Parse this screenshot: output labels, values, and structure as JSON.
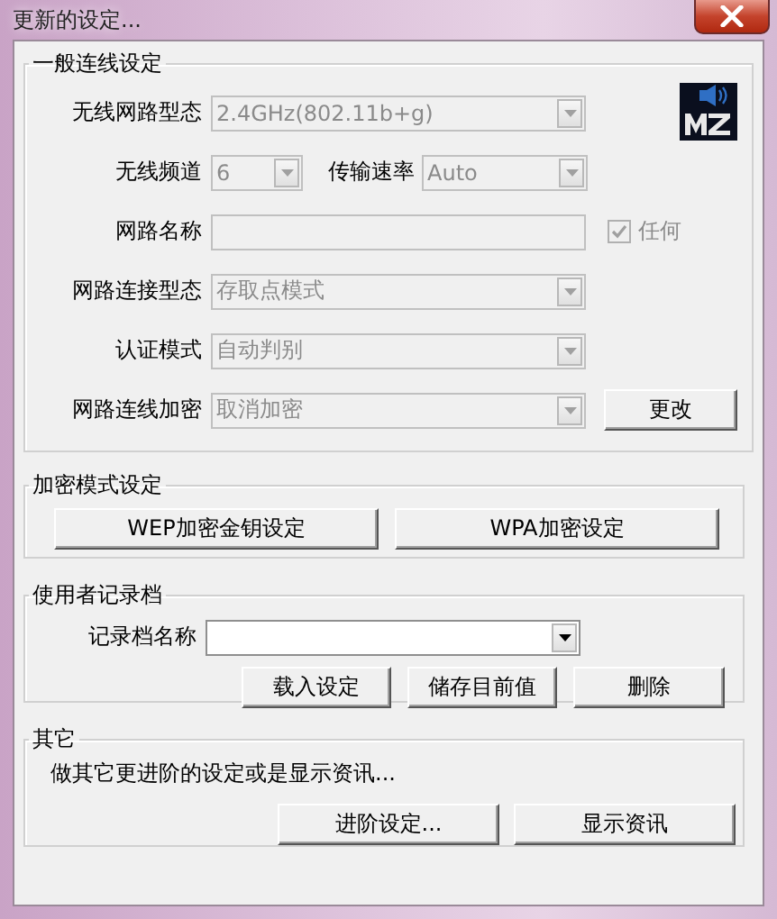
{
  "window": {
    "title": "更新的设定..."
  },
  "general": {
    "title": "一般连线设定",
    "rows": [
      {
        "items": [
          {
            "kind": "label",
            "text": "无线网路型态"
          },
          {
            "kind": "select",
            "value": "2.4GHz(802.11b+g)",
            "disabled": true
          }
        ]
      },
      {
        "items": [
          {
            "kind": "label",
            "text": "无线频道"
          },
          {
            "kind": "short-select",
            "value": "6",
            "disabled": true
          },
          {
            "kind": "inline-label",
            "text": "传输速率"
          },
          {
            "kind": "mid-select",
            "value": "Auto",
            "disabled": true
          }
        ]
      },
      {
        "items": [
          {
            "kind": "label",
            "text": "网路名称"
          },
          {
            "kind": "text",
            "disabled": true
          },
          {
            "kind": "checkbox",
            "text": "任何",
            "checked": true,
            "disabled": true
          }
        ]
      },
      {
        "items": [
          {
            "kind": "label",
            "text": "网路连接型态"
          },
          {
            "kind": "select",
            "value": "存取点模式",
            "disabled": true
          }
        ]
      },
      {
        "items": [
          {
            "kind": "label",
            "text": "认证模式"
          },
          {
            "kind": "select",
            "value": "自动判别",
            "disabled": true
          }
        ]
      },
      {
        "items": [
          {
            "kind": "label",
            "text": "网路连线加密"
          },
          {
            "kind": "select",
            "value": "取消加密",
            "disabled": true
          },
          {
            "kind": "button",
            "text": "更改"
          }
        ]
      }
    ]
  },
  "encryption": {
    "title": "加密模式设定",
    "buttons": [
      "WEP加密金钥设定",
      "WPA加密设定"
    ]
  },
  "profile": {
    "title": "使用者记录档",
    "label": "记录档名称",
    "select": {
      "disabled": false
    },
    "buttons": [
      "载入设定",
      "储存目前值",
      "删除"
    ]
  },
  "other": {
    "title": "其它",
    "description": "做其它更进阶的设定或是显示资讯...",
    "buttons": [
      "进阶设定...",
      "显示资讯"
    ]
  }
}
